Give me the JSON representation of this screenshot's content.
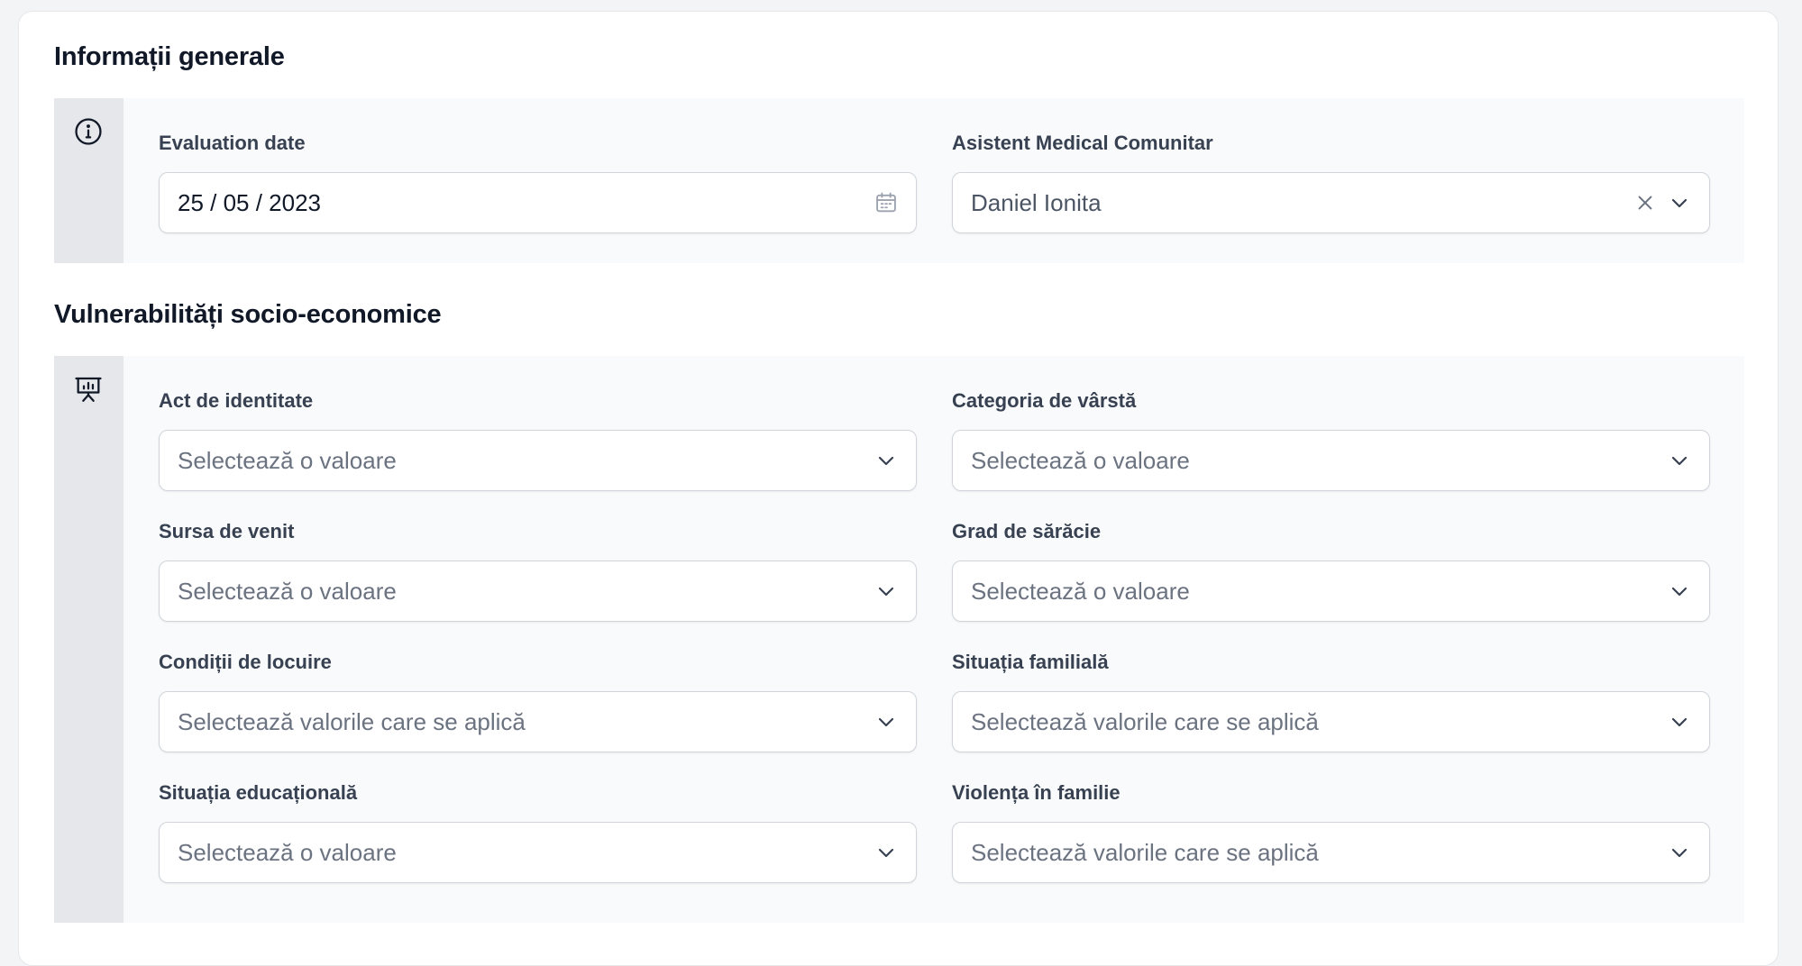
{
  "sections": [
    {
      "title": "Informații generale",
      "icon": "info-icon",
      "fields": [
        {
          "label": "Evaluation date",
          "value": "25 / 05 / 2023",
          "icon": "calendar-icon"
        },
        {
          "label": "Asistent Medical Comunitar",
          "value": "Daniel Ionita",
          "icons": [
            "clear-icon",
            "chevron-down-icon"
          ]
        }
      ]
    },
    {
      "title": "Vulnerabilități socio-economice",
      "icon": "presentation-chart-icon",
      "fields": [
        {
          "label": "Act de identitate",
          "placeholder": "Selectează o valoare"
        },
        {
          "label": "Categoria de vârstă",
          "placeholder": "Selectează o valoare"
        },
        {
          "label": "Sursa de venit",
          "placeholder": "Selectează o valoare"
        },
        {
          "label": "Grad de sărăcie",
          "placeholder": "Selectează o valoare"
        },
        {
          "label": "Condiții de locuire",
          "placeholder": "Selectează valorile care se aplică"
        },
        {
          "label": "Situația familială",
          "placeholder": "Selectează valorile care se aplică"
        },
        {
          "label": "Situația educațională",
          "placeholder": "Selectează o valoare"
        },
        {
          "label": "Violența în familie",
          "placeholder": "Selectează valorile care se aplică"
        }
      ]
    }
  ],
  "colors": {
    "card": "#ffffff",
    "block": "#f9fafb",
    "rail": "#e5e7eb",
    "border": "#d1d5db",
    "label": "#374151",
    "placeholder": "#6b7280"
  }
}
